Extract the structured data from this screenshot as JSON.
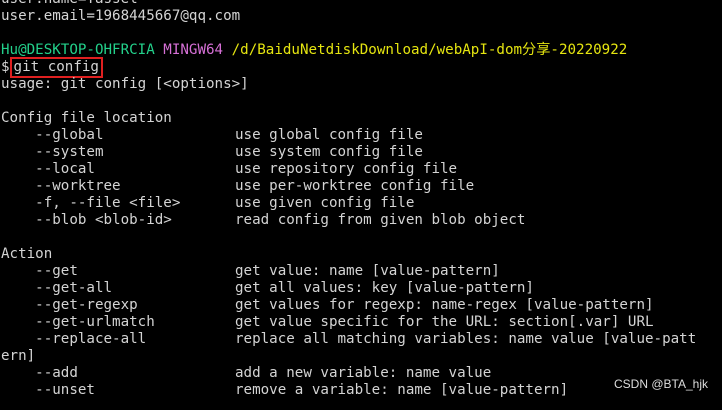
{
  "window": {
    "app": "Git Bash terminal"
  },
  "config_output": {
    "user_name": "user.name=Tassel",
    "user_email": "user.email=1968445667@qq.com"
  },
  "prompt": {
    "user_host": "Hu@DESKTOP-OHFRCIA",
    "system": "MINGW64",
    "path": "/d/BaiduNetdiskDownload/webApI-dom分享-20220922",
    "symbol": "$",
    "command": "git config"
  },
  "usage": "usage: git config [<options>]",
  "sections": {
    "location": {
      "heading": "Config file location",
      "items": [
        {
          "opt": "    --global",
          "desc": "use global config file"
        },
        {
          "opt": "    --system",
          "desc": "use system config file"
        },
        {
          "opt": "    --local",
          "desc": "use repository config file"
        },
        {
          "opt": "    --worktree",
          "desc": "use per-worktree config file"
        },
        {
          "opt": "    -f, --file <file>",
          "desc": "use given config file"
        },
        {
          "opt": "    --blob <blob-id>",
          "desc": "read config from given blob object"
        }
      ]
    },
    "action": {
      "heading": "Action",
      "items": [
        {
          "opt": "    --get",
          "desc": "get value: name [value-pattern]"
        },
        {
          "opt": "    --get-all",
          "desc": "get all values: key [value-pattern]"
        },
        {
          "opt": "    --get-regexp",
          "desc": "get values for regexp: name-regex [value-pattern]"
        },
        {
          "opt": "    --get-urlmatch",
          "desc": "get value specific for the URL: section[.var] URL"
        },
        {
          "opt": "    --replace-all",
          "desc": "replace all matching variables: name value [value-patt"
        }
      ],
      "wrap": "ern]",
      "items2": [
        {
          "opt": "    --add",
          "desc": "add a new variable: name value"
        },
        {
          "opt": "    --unset",
          "desc": "remove a variable: name [value-pattern]"
        }
      ]
    }
  },
  "watermark": "CSDN @BTA_hjk",
  "colors": {
    "background": "#000000",
    "text": "#d4d4d4",
    "prompt_user": "#23d18b",
    "prompt_system": "#d670d6",
    "prompt_path": "#e5e510",
    "highlight_box": "#e02020"
  }
}
